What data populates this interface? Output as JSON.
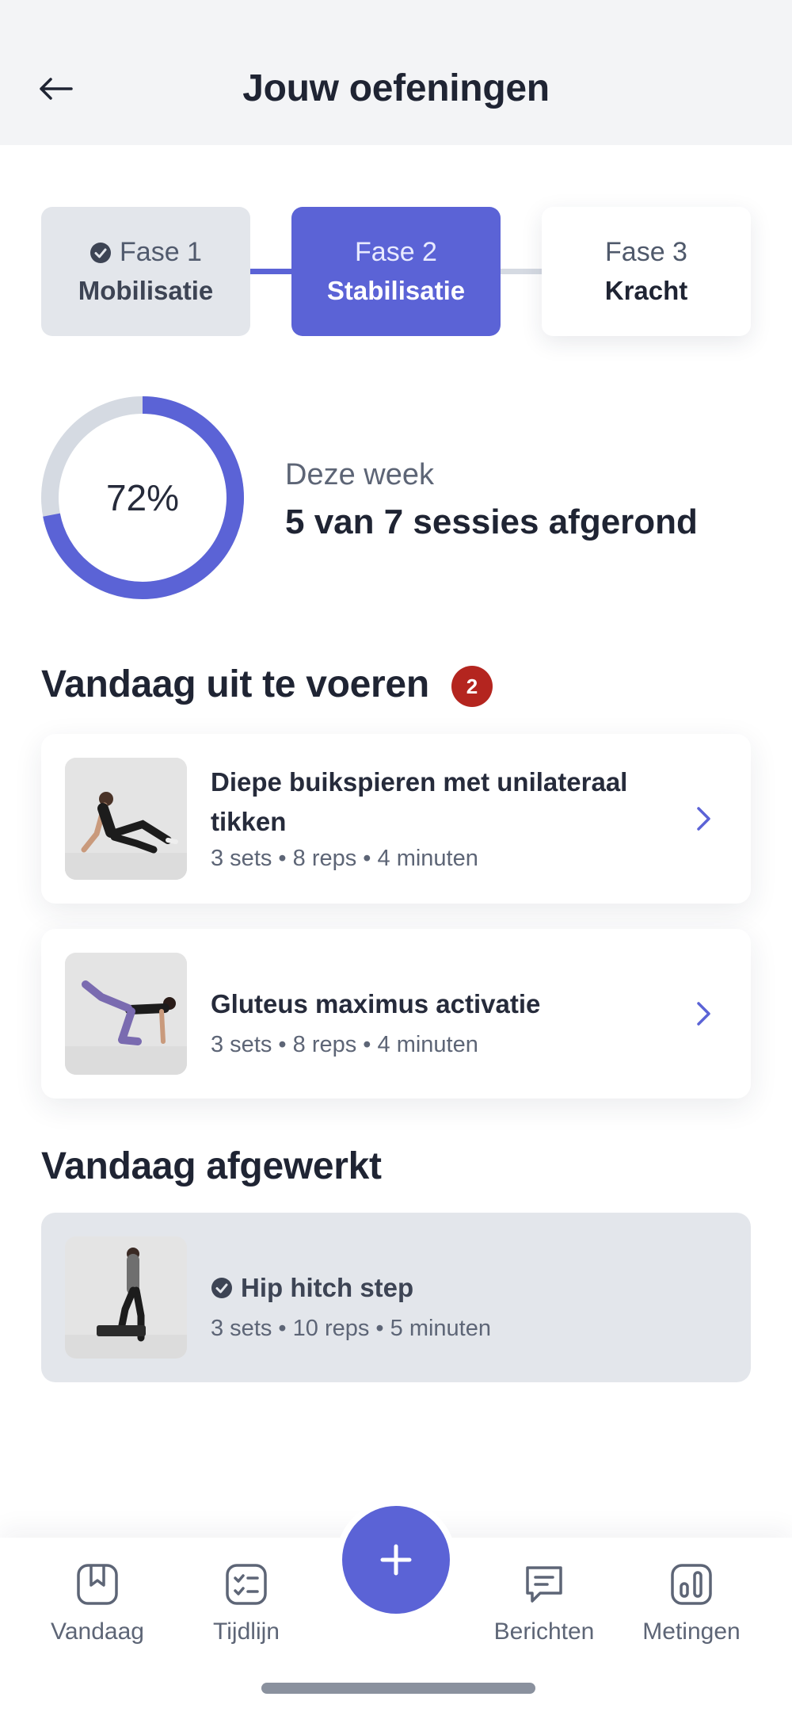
{
  "header": {
    "title": "Jouw oefeningen",
    "back_icon": "arrow-left-icon"
  },
  "phases": [
    {
      "number": "Fase 1",
      "name": "Mobilisatie",
      "status": "completed"
    },
    {
      "number": "Fase 2",
      "name": "Stabilisatie",
      "status": "active"
    },
    {
      "number": "Fase 3",
      "name": "Kracht",
      "status": "upcoming"
    }
  ],
  "progress": {
    "percent_label": "72%",
    "percent": 72,
    "week_label": "Deze week",
    "week_value": "5 van 7 sessies afgerond"
  },
  "todo": {
    "title": "Vandaag uit te voeren",
    "badge": "2",
    "items": [
      {
        "title": "Diepe buikspieren met unilateraal tikken",
        "meta": "3 sets • 8 reps • 4 minuten"
      },
      {
        "title": "Gluteus maximus activatie",
        "meta": "3 sets • 8 reps • 4 minuten"
      }
    ]
  },
  "done": {
    "title": "Vandaag afgewerkt",
    "items": [
      {
        "title": "Hip hitch step",
        "meta": "3 sets • 10 reps • 5 minuten"
      }
    ]
  },
  "nav": {
    "items": [
      {
        "label": "Vandaag",
        "icon": "bookmark-book-icon"
      },
      {
        "label": "Tijdlijn",
        "icon": "checklist-icon"
      },
      {
        "label": "Berichten",
        "icon": "message-icon"
      },
      {
        "label": "Metingen",
        "icon": "bar-chart-icon"
      }
    ],
    "fab_icon": "plus-icon"
  },
  "colors": {
    "accent": "#5b63d6",
    "badge": "#b4251f",
    "muted_bg": "#e3e6eb"
  }
}
